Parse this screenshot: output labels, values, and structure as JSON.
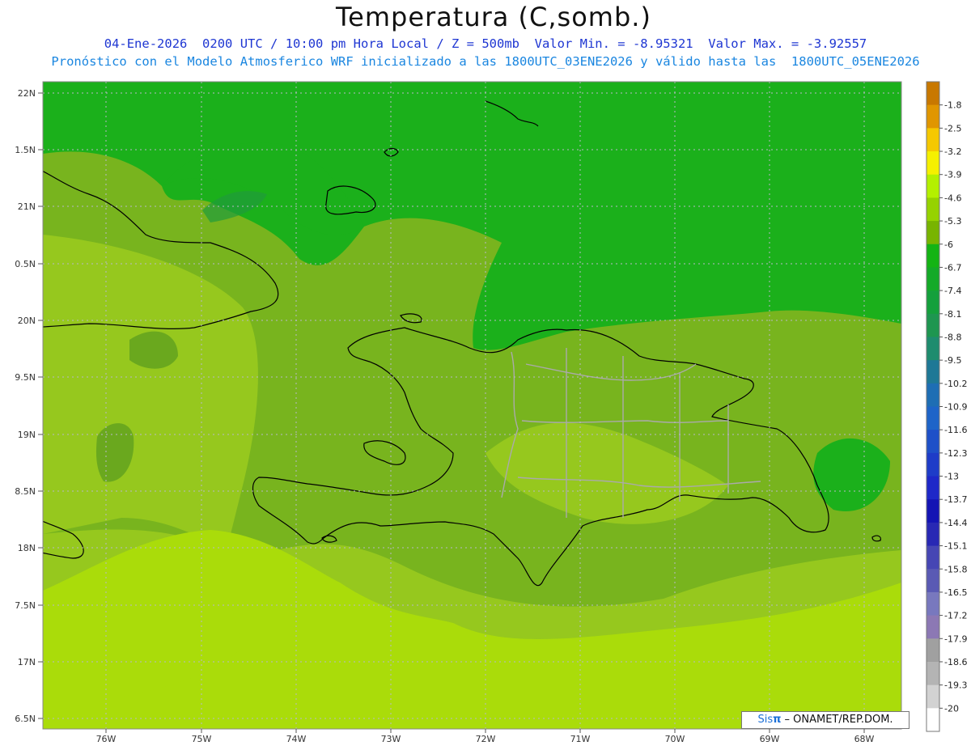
{
  "header": {
    "title": "Temperatura (C,somb.)",
    "line1": "04-Ene-2026  0200 UTC / 10:00 pm Hora Local / Z = 500mb  Valor Min. = -8.95321  Valor Max. = -3.92557",
    "line2": "Pronóstico con el Modelo Atmosferico WRF inicializado a las 1800UTC_03ENE2026 y válido hasta las  1800UTC_05ENE2026"
  },
  "map": {
    "lat_labels": [
      "22N",
      "1.5N",
      "21N",
      "0.5N",
      "20N",
      "9.5N",
      "19N",
      "8.5N",
      "18N",
      "7.5N",
      "17N",
      "6.5N"
    ],
    "lon_labels": [
      "76W",
      "75W",
      "74W",
      "73W",
      "72W",
      "71W",
      "70W",
      "69W",
      "68W"
    ],
    "field_colors": {
      "ocean_north": "#1bb01b",
      "mid_band": "#78b41e",
      "light_band": "#96c81e",
      "south_band": "#aadc0a",
      "dark_patch": "#1f9b3a"
    }
  },
  "colorbar": {
    "labels": [
      "-1.8",
      "-2.5",
      "-3.2",
      "-3.9",
      "-4.6",
      "-5.3",
      "-6",
      "-6.7",
      "-7.4",
      "-8.1",
      "-8.8",
      "-9.5",
      "-10.2",
      "-10.9",
      "-11.6",
      "-12.3",
      "-13",
      "-13.7",
      "-14.4",
      "-15.1",
      "-15.8",
      "-16.5",
      "-17.2",
      "-17.9",
      "-18.6",
      "-19.3",
      "-20"
    ],
    "colors": [
      "#c87800",
      "#e09600",
      "#f5c800",
      "#f5f000",
      "#b4f000",
      "#96d200",
      "#78b400",
      "#14b414",
      "#14aa28",
      "#14a03c",
      "#1e9650",
      "#1e8c6e",
      "#1e7896",
      "#1e6eb4",
      "#1e64c8",
      "#1e50c8",
      "#1e3cc8",
      "#1e28c8",
      "#1414b4",
      "#2828b4",
      "#4646b4",
      "#5a5ab4",
      "#7878be",
      "#8c78b4",
      "#a0a0a0",
      "#b4b4b4",
      "#d2d2d2",
      "#ffffff"
    ]
  },
  "credit": {
    "brand": "Sis",
    "pi": "π",
    "org": " – ONAMET/REP.DOM."
  }
}
